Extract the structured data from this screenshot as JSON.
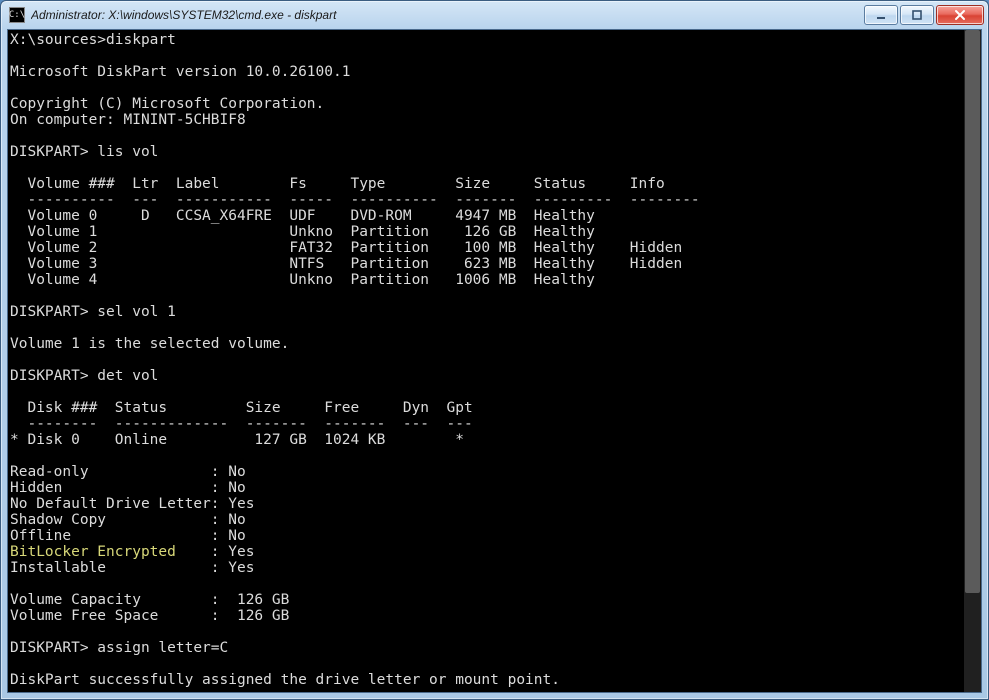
{
  "window": {
    "title": "Administrator: X:\\windows\\SYSTEM32\\cmd.exe - diskpart"
  },
  "prompt_path": "X:\\sources>",
  "cmd_diskpart": "diskpart",
  "version_line": "Microsoft DiskPart version 10.0.26100.1",
  "copyright_line": "Copyright (C) Microsoft Corporation.",
  "computer_line": "On computer: MININT-5CHBIF8",
  "diskpart_prompt": "DISKPART>",
  "cmd_lisvol": "lis vol",
  "vol_header": {
    "volume": "Volume ###",
    "ltr": "Ltr",
    "label": "Label",
    "fs": "Fs",
    "type": "Type",
    "size": "Size",
    "status": "Status",
    "info": "Info"
  },
  "volumes": [
    {
      "name": "Volume 0",
      "ltr": "D",
      "label": "CCSA_X64FRE",
      "fs": "UDF",
      "type": "DVD-ROM",
      "size": "4947 MB",
      "status": "Healthy",
      "info": ""
    },
    {
      "name": "Volume 1",
      "ltr": "",
      "label": "",
      "fs": "Unkno",
      "type": "Partition",
      "size": "126 GB",
      "status": "Healthy",
      "info": ""
    },
    {
      "name": "Volume 2",
      "ltr": "",
      "label": "",
      "fs": "FAT32",
      "type": "Partition",
      "size": "100 MB",
      "status": "Healthy",
      "info": "Hidden"
    },
    {
      "name": "Volume 3",
      "ltr": "",
      "label": "",
      "fs": "NTFS",
      "type": "Partition",
      "size": "623 MB",
      "status": "Healthy",
      "info": "Hidden"
    },
    {
      "name": "Volume 4",
      "ltr": "",
      "label": "",
      "fs": "Unkno",
      "type": "Partition",
      "size": "1006 MB",
      "status": "Healthy",
      "info": ""
    }
  ],
  "cmd_selvol": "sel vol 1",
  "selvol_result": "Volume 1 is the selected volume.",
  "cmd_detvol": "det vol",
  "disk_header": {
    "disk": "Disk ###",
    "status": "Status",
    "size": "Size",
    "free": "Free",
    "dyn": "Dyn",
    "gpt": "Gpt"
  },
  "disks": [
    {
      "marker": "*",
      "name": "Disk 0",
      "status": "Online",
      "size": "127 GB",
      "free": "1024 KB",
      "dyn": "",
      "gpt": "*"
    }
  ],
  "props": [
    {
      "label": "Read-only",
      "value": "No"
    },
    {
      "label": "Hidden",
      "value": "No"
    },
    {
      "label": "No Default Drive Letter",
      "value": "Yes"
    },
    {
      "label": "Shadow Copy",
      "value": "No"
    },
    {
      "label": "Offline",
      "value": "No"
    },
    {
      "label": "BitLocker Encrypted",
      "value": "Yes",
      "hl": true
    },
    {
      "label": "Installable",
      "value": "Yes"
    }
  ],
  "capacity": [
    {
      "label": "Volume Capacity",
      "value": "126 GB"
    },
    {
      "label": "Volume Free Space",
      "value": "126 GB"
    }
  ],
  "cmd_assign": "assign letter=C",
  "assign_result": "DiskPart successfully assigned the drive letter or mount point."
}
